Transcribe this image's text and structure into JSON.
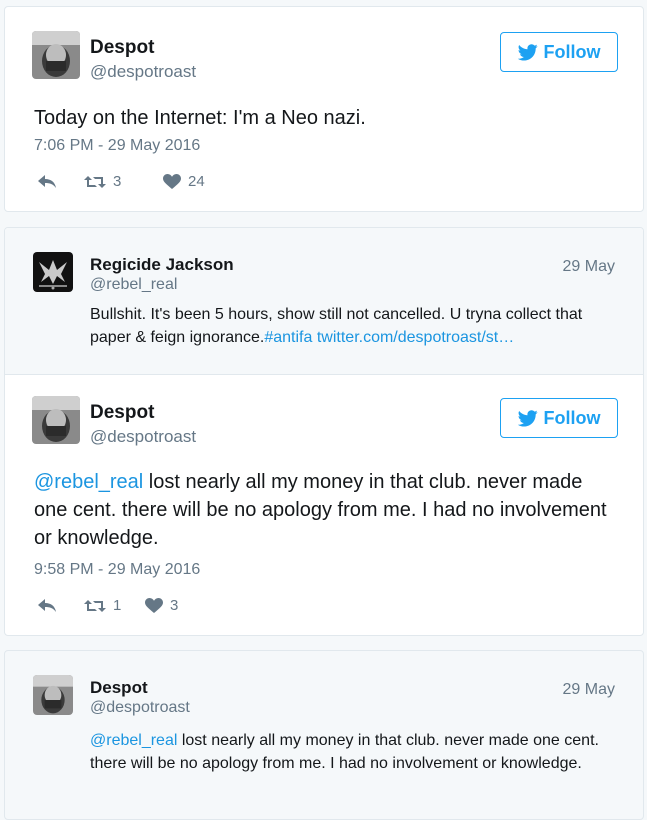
{
  "tweets": [
    {
      "name": "Despot",
      "handle": "@despotroast",
      "follow_label": "Follow",
      "text": "Today on the Internet: I'm a Neo nazi.",
      "timestamp": "7:06 PM - 29 May 2016",
      "retweets": "3",
      "likes": "24"
    },
    {
      "name": "Despot",
      "handle": "@despotroast",
      "follow_label": "Follow",
      "mention": "@rebel_real",
      "text": " lost nearly all my money in that club. never made one cent. there will be no apology from me. I had no involvement or knowledge.",
      "timestamp": "9:58 PM - 29 May 2016",
      "retweets": "1",
      "likes": "3"
    }
  ],
  "replies": [
    {
      "name": "Regicide Jackson",
      "handle": "@rebel_real",
      "date": "29 May",
      "text": "Bullshit. It's been 5 hours, show still not cancelled. U tryna collect that paper & feign ignorance.",
      "hashtag": "#antifa",
      "link": "twitter.com/despotroast/st…"
    },
    {
      "name": "Despot",
      "handle": "@despotroast",
      "date": "29 May",
      "mention": "@rebel_real",
      "text": " lost nearly all my money in that club. never made one cent. there will be no apology from me. I had no involvement or knowledge."
    }
  ],
  "colors": {
    "accent": "#1da1f2",
    "link": "#1b95e0",
    "muted": "#657786",
    "text": "#14171a",
    "quote_bg": "#f5f8fa"
  }
}
